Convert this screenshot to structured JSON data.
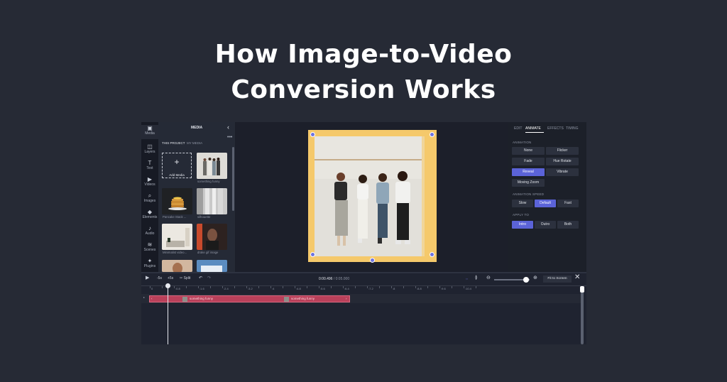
{
  "headline": {
    "line1": "How Image-to-Video",
    "line2": "Conversion Works"
  },
  "rail": {
    "items": [
      {
        "label": "Media",
        "icon": "media-icon",
        "glyph": "▣"
      },
      {
        "label": "Layers",
        "icon": "layers-icon",
        "glyph": "◫"
      },
      {
        "label": "Text",
        "icon": "text-icon",
        "glyph": "T"
      },
      {
        "label": "Videos",
        "icon": "video-icon",
        "glyph": "▶"
      },
      {
        "label": "Images",
        "icon": "image-icon",
        "glyph": "⌕"
      },
      {
        "label": "Elements",
        "icon": "elements-icon",
        "glyph": "◆"
      },
      {
        "label": "Audio",
        "icon": "audio-icon",
        "glyph": "♪"
      },
      {
        "label": "Scenes",
        "icon": "scenes-icon",
        "glyph": "≋"
      },
      {
        "label": "Plugins",
        "icon": "plugins-icon",
        "glyph": "✦"
      }
    ]
  },
  "media": {
    "title": "MEDIA",
    "tabs": [
      "THIS PROJECT",
      "MY MEDIA"
    ],
    "add_label": "Add Media",
    "captions": [
      "something funny",
      "Pancake Stack ...",
      "silhouette",
      "Minimalist video...",
      "drake gif image",
      "",
      ""
    ]
  },
  "right_panel": {
    "tabs": [
      "EDIT",
      "ANIMATE",
      "EFFECTS",
      "TIMING"
    ],
    "animation_label": "ANIMATION",
    "animations": [
      "None",
      "Flicker",
      "Fade",
      "Hue Rotate",
      "Reveal",
      "Vibrate",
      "Moving Zoom"
    ],
    "selected_animation": "Reveal",
    "speed_label": "ANIMATION SPEED",
    "speeds": [
      "Slow",
      "Default",
      "Fast"
    ],
    "selected_speed": "Default",
    "apply_label": "APPLY TO",
    "apply": [
      "Intro",
      "Outro",
      "Both"
    ],
    "selected_apply": "Intro",
    "accent": "#5b63d8"
  },
  "timeline": {
    "back5": "-5s",
    "fwd5": "+5s",
    "split": "Split",
    "current_time": "0:00.496",
    "total_time": "/ 0:05.000",
    "fit_label": "Fit to Screen",
    "ticks": [
      "0",
      ":0.4",
      ":0.8",
      ":1.2",
      ":1.6",
      ":2",
      ":2.4",
      ":2.8",
      ":3.2",
      ":3.6",
      ":4",
      ":4.4",
      ":4.8",
      ":5.2",
      ":5.6",
      ":6",
      ":6.4",
      ":6.8",
      ":7.2",
      ":7.6",
      ":8",
      ":8.4",
      ":8.8",
      ":9.2",
      ":9.6",
      ":10",
      ":10.4",
      ":10.8"
    ],
    "clip_labels": [
      "something funny",
      "something funny"
    ],
    "clip_color": "#b9405a"
  }
}
